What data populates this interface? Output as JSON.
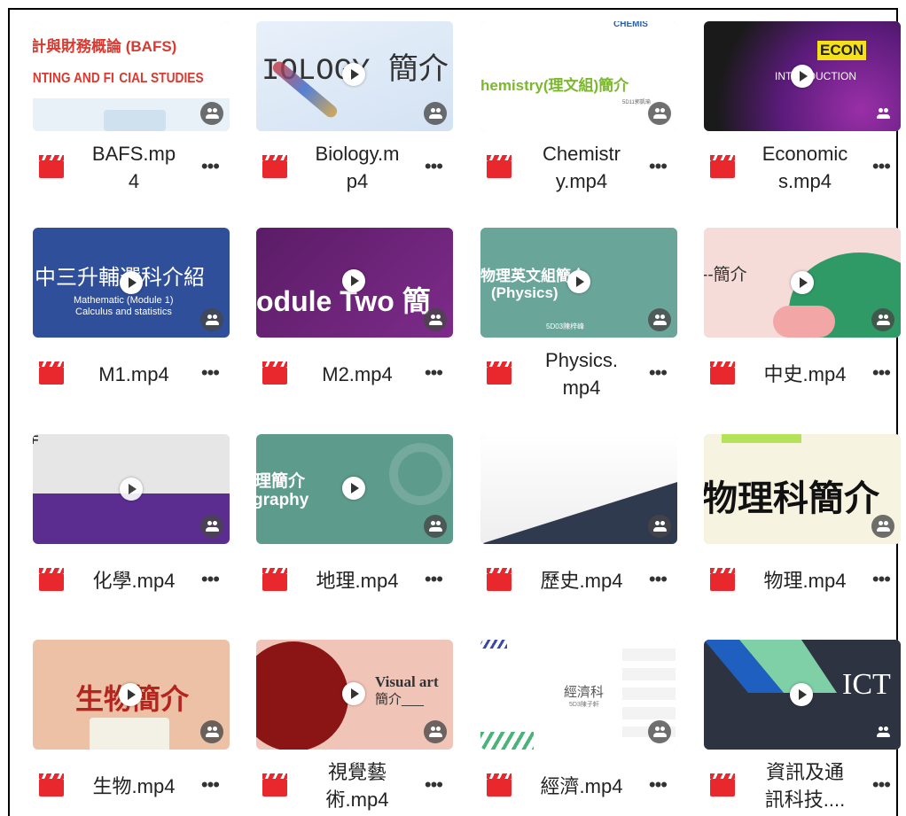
{
  "files": [
    {
      "name": "BAFS.mp\n4",
      "thumb": {
        "line1": "計與財務概論 (BAFS)",
        "line2": "INTING AND FI  CIAL STUDIES"
      }
    },
    {
      "name": "Biology.m\np4",
      "thumb": {
        "line1": "IOLOGY 簡介"
      }
    },
    {
      "name": "Chemistr\ny.mp4",
      "thumb": {
        "line1": "hemistry(理文組)簡介",
        "line2": "5D11郭凱瑜",
        "top": "CHEMIS"
      }
    },
    {
      "name": "Economic\ns.mp4",
      "thumb": {
        "badge": "ECON",
        "line1": "INTRODUCTION"
      }
    },
    {
      "name": "M1.mp4",
      "thumb": {
        "line1": "中三升輔選科介紹",
        "line2": "Mathematic (Module 1)",
        "line3": "Calculus and statistics"
      }
    },
    {
      "name": "M2.mp4",
      "thumb": {
        "line1": "odule Two 簡"
      }
    },
    {
      "name": "Physics.\nmp4",
      "thumb": {
        "line1": "物理英文組簡介",
        "line2": "(Physics)",
        "line3": "5D03陳梓峰"
      }
    },
    {
      "name": "中史.mp4",
      "thumb": {
        "line1": "--簡介"
      }
    },
    {
      "name": "化學.mp4",
      "thumb": {
        "line1": "F"
      }
    },
    {
      "name": "地理.mp4",
      "thumb": {
        "line1": "理簡介",
        "line2": "graphy"
      }
    },
    {
      "name": "歷史.mp4",
      "thumb": {}
    },
    {
      "name": "物理.mp4",
      "thumb": {
        "line1": "物理科簡介"
      }
    },
    {
      "name": "生物.mp4",
      "thumb": {
        "line1": "生物簡介"
      }
    },
    {
      "name": "視覺藝\n術.mp4",
      "thumb": {
        "line1": "Visual art",
        "line2": "簡介___"
      }
    },
    {
      "name": "經濟.mp4",
      "thumb": {
        "line1": "經濟科",
        "line2": "5D3陳子軒"
      }
    },
    {
      "name": "資訊及通\n訊科技....",
      "thumb": {
        "line1": "ICT"
      }
    }
  ],
  "more_label": "•••",
  "colors": {
    "file_icon": "#e8282c",
    "text": "#222222"
  },
  "icons": {
    "file": "video-file-icon",
    "play": "play-icon",
    "shared": "shared-people-icon",
    "more": "more-options-icon"
  }
}
